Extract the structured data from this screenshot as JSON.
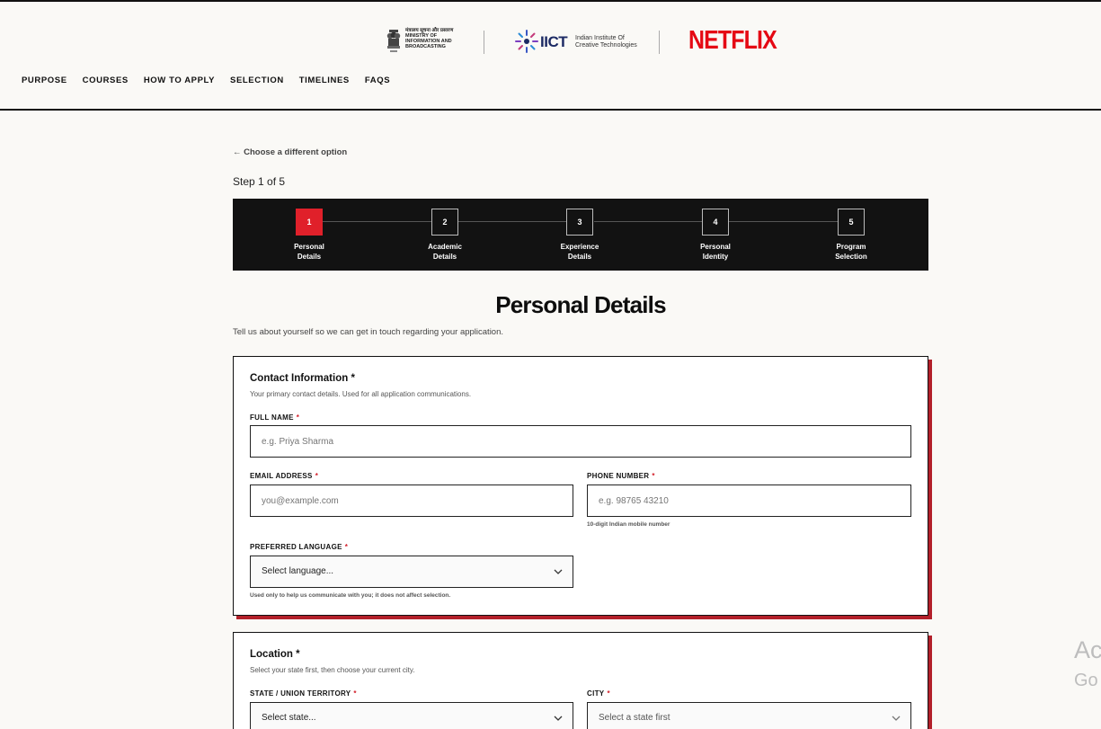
{
  "header": {
    "mib_text": "मंत्रालय सूचना और प्रसारण MINISTRY OF INFORMATION AND BROADCASTING",
    "iict_word": "IICT",
    "iict_sub": "Indian Institute Of Creative Technologies",
    "netflix": "NETFLIX",
    "nav": [
      "PURPOSE",
      "COURSES",
      "HOW TO APPLY",
      "SELECTION",
      "TIMELINES",
      "FAQS"
    ]
  },
  "back_link": "← Choose a different option",
  "step_label": "Step 1 of 5",
  "steps": [
    {
      "num": "1",
      "line1": "Personal",
      "line2": "Details"
    },
    {
      "num": "2",
      "line1": "Academic",
      "line2": "Details"
    },
    {
      "num": "3",
      "line1": "Experience",
      "line2": "Details"
    },
    {
      "num": "4",
      "line1": "Personal",
      "line2": "Identity"
    },
    {
      "num": "5",
      "line1": "Program",
      "line2": "Selection"
    }
  ],
  "page_title": "Personal Details",
  "page_sub": "Tell us about yourself so we can get in touch regarding your application.",
  "contact": {
    "title": "Contact Information *",
    "sub": "Your primary contact details. Used for all application communications.",
    "full_name_label": "FULL NAME",
    "full_name_placeholder": "e.g. Priya Sharma",
    "email_label": "EMAIL ADDRESS",
    "email_placeholder": "you@example.com",
    "phone_label": "PHONE NUMBER",
    "phone_placeholder": "e.g. 98765 43210",
    "phone_hint": "10-digit Indian mobile number",
    "language_label": "PREFERRED LANGUAGE",
    "language_value": "Select language...",
    "language_hint": "Used only to help us communicate with you; it does not affect selection."
  },
  "location": {
    "title": "Location *",
    "sub": "Select your state first, then choose your current city.",
    "state_label": "STATE / UNION TERRITORY",
    "state_value": "Select state...",
    "city_label": "CITY",
    "city_value": "Select a state first"
  },
  "required_mark": "*",
  "watermark": {
    "line1": "Ac",
    "line2": "Go"
  },
  "colors": {
    "accent": "#e0202a",
    "netflix": "#e50914",
    "stepper_bg": "#121212"
  }
}
